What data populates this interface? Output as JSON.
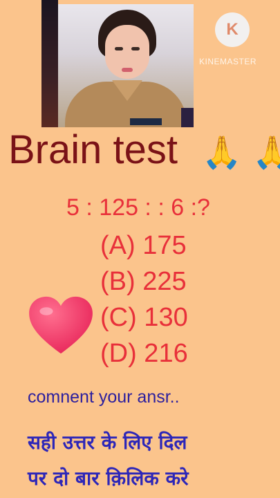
{
  "branding": {
    "logo_letter": "K",
    "logo_text": "KINEMASTER"
  },
  "title": "Brain test",
  "emoji": {
    "pray": "🙏"
  },
  "question": "5 : 125 : : 6 :?",
  "options": [
    "(A) 175",
    "(B) 225",
    "(C) 130",
    "(D) 216"
  ],
  "comment_prompt": "comnent your ansr..",
  "instruction": {
    "line1": "सही उत्तर के लिए दिल",
    "line2": "पर दो बार क़िलिक करे"
  },
  "colors": {
    "background": "#fbc48c",
    "title": "#7a1217",
    "question": "#e8303a",
    "comment": "#2c1f9e",
    "instruction": "#2d26b8",
    "heart": "#e8265a"
  },
  "icons": {
    "heart": "heart-icon",
    "pray": "folded-hands-icon",
    "logo": "kinemaster-logo"
  }
}
